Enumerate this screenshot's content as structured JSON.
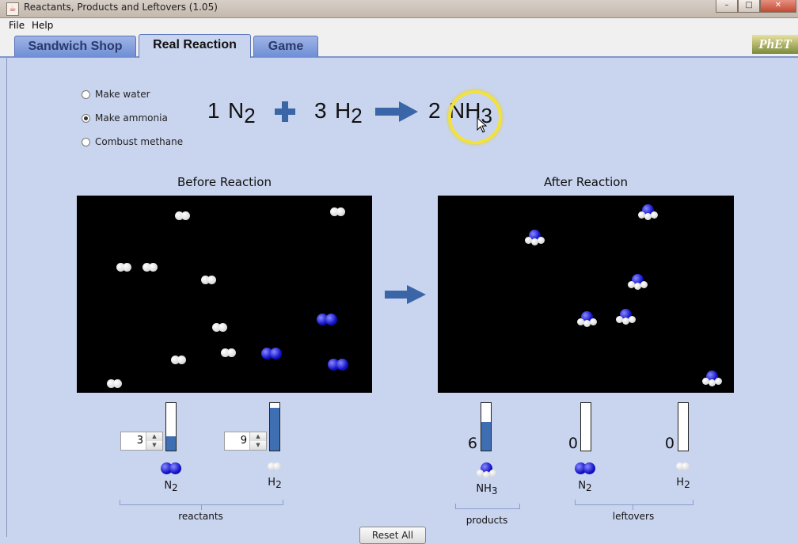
{
  "window": {
    "title": "Reactants, Products and Leftovers (1.05)"
  },
  "menu": {
    "file": "File",
    "help": "Help"
  },
  "tabs": [
    {
      "label": "Sandwich Shop"
    },
    {
      "label": "Real Reaction"
    },
    {
      "label": "Game"
    }
  ],
  "logo": "PhET",
  "reaction_options": {
    "water": "Make water",
    "ammonia": "Make ammonia",
    "methane": "Combust methane",
    "selected": "Make ammonia"
  },
  "equation": {
    "n2_coef": "1",
    "n2_base": "N",
    "n2_sub": "2",
    "h2_coef": "3",
    "h2_base": "H",
    "h2_sub": "2",
    "nh3_coef": "2",
    "nh3_base": "NH",
    "nh3_sub": "3"
  },
  "before": {
    "title": "Before Reaction"
  },
  "after": {
    "title": "After Reaction"
  },
  "reactants": {
    "n2": {
      "count": "3",
      "base": "N",
      "sub": "2",
      "fill": 0.3
    },
    "h2": {
      "count": "9",
      "base": "H",
      "sub": "2",
      "fill": 0.9
    },
    "group_label": "reactants"
  },
  "products": {
    "nh3": {
      "count": "6",
      "base": "NH",
      "sub": "3",
      "fill": 0.6
    },
    "group_label": "products"
  },
  "leftovers": {
    "n2": {
      "count": "0",
      "base": "N",
      "sub": "2",
      "fill": 0
    },
    "h2": {
      "count": "0",
      "base": "H",
      "sub": "2",
      "fill": 0
    },
    "group_label": "leftovers"
  },
  "buttons": {
    "reset_all": "Reset All"
  },
  "colors": {
    "accent": "#3a66a8",
    "panel": "#c9d4ee",
    "gauge_fill": "#3f6fb3"
  }
}
